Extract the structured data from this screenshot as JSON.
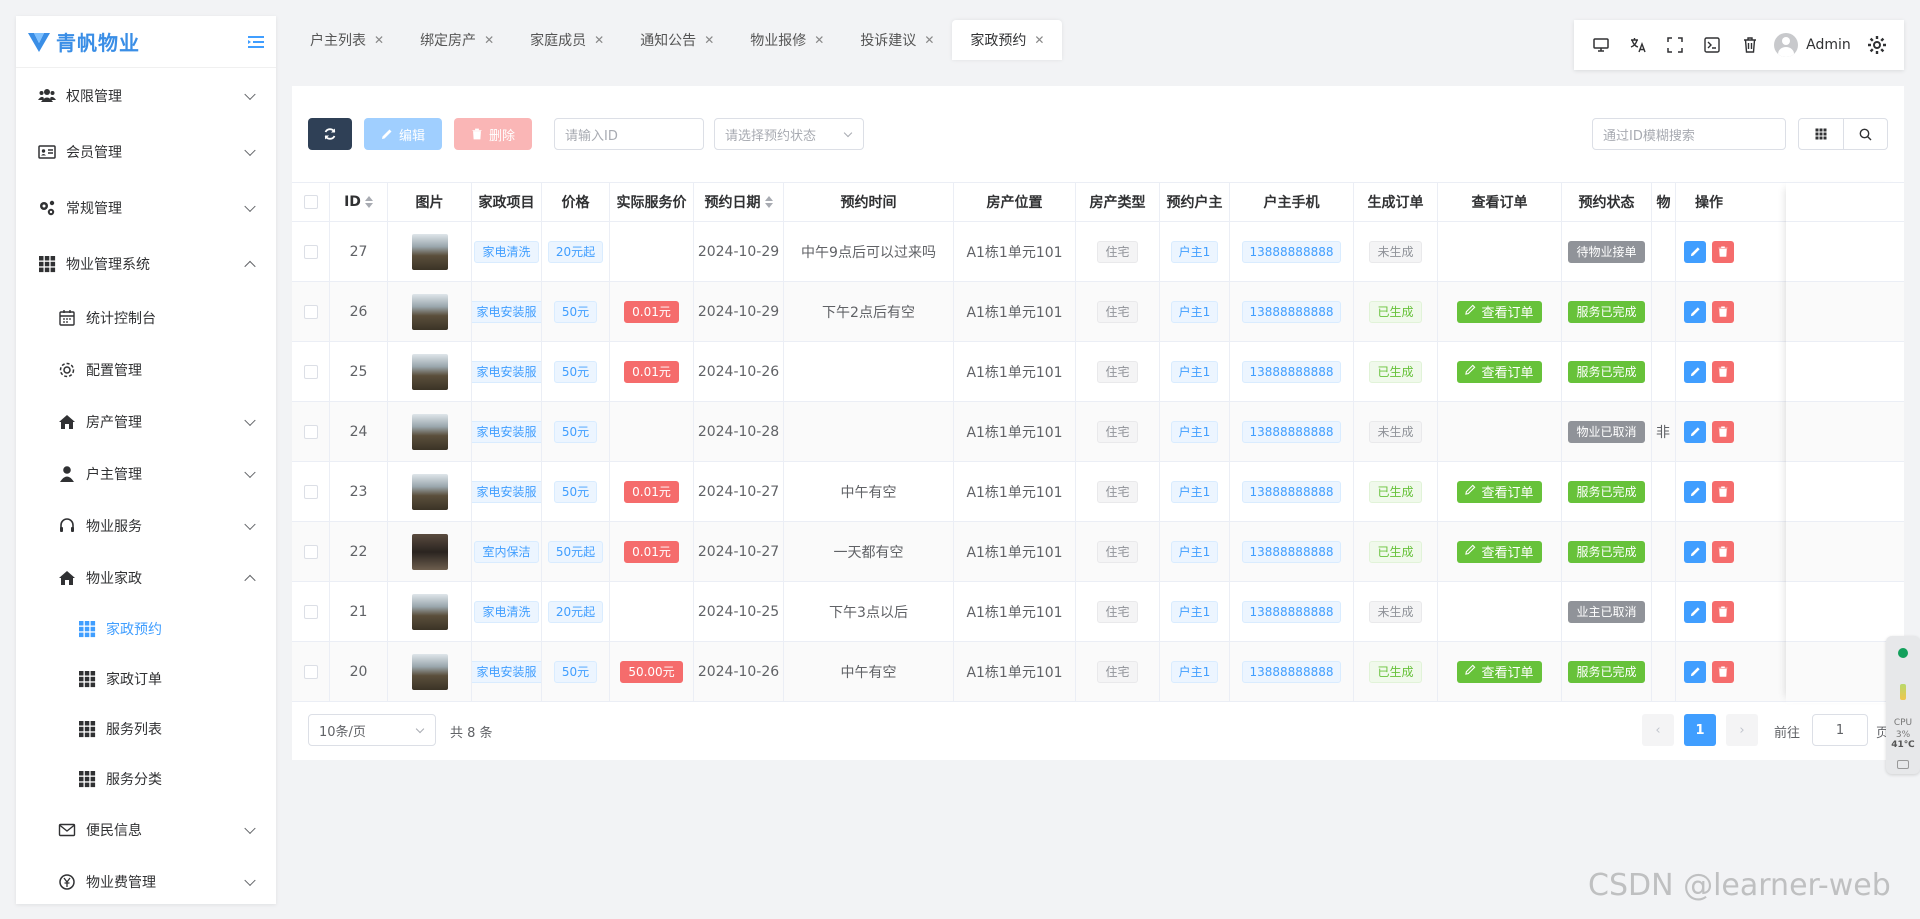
{
  "app": {
    "logo_text": "青帆物业"
  },
  "sidebar": {
    "items": [
      {
        "label": "权限管理",
        "level": 0,
        "icon": "users-icon",
        "chevron": "down"
      },
      {
        "label": "会员管理",
        "level": 0,
        "icon": "id-card-icon",
        "chevron": "down"
      },
      {
        "label": "常规管理",
        "level": 0,
        "icon": "gears-icon",
        "chevron": "down"
      },
      {
        "label": "物业管理系统",
        "level": 0,
        "icon": "grid-icon",
        "chevron": "up"
      },
      {
        "label": "统计控制台",
        "level": 1,
        "icon": "calendar-icon",
        "chevron": ""
      },
      {
        "label": "配置管理",
        "level": 1,
        "icon": "gear-icon",
        "chevron": ""
      },
      {
        "label": "房产管理",
        "level": 1,
        "icon": "home-icon",
        "chevron": "down"
      },
      {
        "label": "户主管理",
        "level": 1,
        "icon": "user-icon",
        "chevron": "down"
      },
      {
        "label": "物业服务",
        "level": 1,
        "icon": "headset-icon",
        "chevron": "down"
      },
      {
        "label": "物业家政",
        "level": 1,
        "icon": "home-icon",
        "chevron": "up"
      },
      {
        "label": "家政预约",
        "level": 2,
        "icon": "grid-icon",
        "chevron": "",
        "active": true
      },
      {
        "label": "家政订单",
        "level": 2,
        "icon": "grid-icon",
        "chevron": ""
      },
      {
        "label": "服务列表",
        "level": 2,
        "icon": "grid-icon",
        "chevron": ""
      },
      {
        "label": "服务分类",
        "level": 2,
        "icon": "grid-icon",
        "chevron": ""
      },
      {
        "label": "便民信息",
        "level": 1,
        "icon": "mail-icon",
        "chevron": "down"
      },
      {
        "label": "物业费管理",
        "level": 1,
        "icon": "money-icon",
        "chevron": "down"
      }
    ]
  },
  "tabs": [
    {
      "label": "户主列表",
      "active": false
    },
    {
      "label": "绑定房产",
      "active": false
    },
    {
      "label": "家庭成员",
      "active": false
    },
    {
      "label": "通知公告",
      "active": false
    },
    {
      "label": "物业报修",
      "active": false
    },
    {
      "label": "投诉建议",
      "active": false
    },
    {
      "label": "家政预约",
      "active": true
    }
  ],
  "topbar": {
    "user": "Admin"
  },
  "toolbar": {
    "edit_label": "编辑",
    "delete_label": "删除",
    "id_placeholder": "请输入ID",
    "status_placeholder": "请选择预约状态",
    "search_placeholder": "通过ID模糊搜索"
  },
  "table": {
    "headers": [
      "ID",
      "图片",
      "家政项目",
      "价格",
      "实际服务价",
      "预约日期",
      "预约时间",
      "房产位置",
      "房产类型",
      "预约户主",
      "户主手机",
      "生成订单",
      "查看订单",
      "预约状态",
      "物",
      "操作"
    ],
    "view_order_label": "查看订单",
    "rows": [
      {
        "id": "27",
        "img": "light",
        "project": "家电清洗",
        "price": "20元起",
        "actual": "",
        "date": "2024-10-29",
        "time": "中午9点后可以过来吗",
        "location": "A1栋1单元101",
        "type": "住宅",
        "owner": "户主1",
        "phone": "13888888888",
        "order": "未生成",
        "order_state": "none",
        "view": false,
        "status": "待物业接单",
        "status_color": "gray",
        "extra": ""
      },
      {
        "id": "26",
        "img": "light",
        "project": "家电安装服",
        "price": "50元",
        "actual": "0.01元",
        "date": "2024-10-29",
        "time": "下午2点后有空",
        "location": "A1栋1单元101",
        "type": "住宅",
        "owner": "户主1",
        "phone": "13888888888",
        "order": "已生成",
        "order_state": "done",
        "view": true,
        "status": "服务已完成",
        "status_color": "green",
        "extra": ""
      },
      {
        "id": "25",
        "img": "light",
        "project": "家电安装服",
        "price": "50元",
        "actual": "0.01元",
        "date": "2024-10-26",
        "time": "",
        "location": "A1栋1单元101",
        "type": "住宅",
        "owner": "户主1",
        "phone": "13888888888",
        "order": "已生成",
        "order_state": "done",
        "view": true,
        "status": "服务已完成",
        "status_color": "green",
        "extra": ""
      },
      {
        "id": "24",
        "img": "light",
        "project": "家电安装服",
        "price": "50元",
        "actual": "",
        "date": "2024-10-28",
        "time": "",
        "location": "A1栋1单元101",
        "type": "住宅",
        "owner": "户主1",
        "phone": "13888888888",
        "order": "未生成",
        "order_state": "none",
        "view": false,
        "status": "物业已取消",
        "status_color": "gray",
        "extra": "非"
      },
      {
        "id": "23",
        "img": "light",
        "project": "家电安装服",
        "price": "50元",
        "actual": "0.01元",
        "date": "2024-10-27",
        "time": "中午有空",
        "location": "A1栋1单元101",
        "type": "住宅",
        "owner": "户主1",
        "phone": "13888888888",
        "order": "已生成",
        "order_state": "done",
        "view": true,
        "status": "服务已完成",
        "status_color": "green",
        "extra": ""
      },
      {
        "id": "22",
        "img": "dark",
        "project": "室内保洁",
        "price": "50元起",
        "actual": "0.01元",
        "date": "2024-10-27",
        "time": "一天都有空",
        "location": "A1栋1单元101",
        "type": "住宅",
        "owner": "户主1",
        "phone": "13888888888",
        "order": "已生成",
        "order_state": "done",
        "view": true,
        "status": "服务已完成",
        "status_color": "green",
        "extra": ""
      },
      {
        "id": "21",
        "img": "light",
        "project": "家电清洗",
        "price": "20元起",
        "actual": "",
        "date": "2024-10-25",
        "time": "下午3点以后",
        "location": "A1栋1单元101",
        "type": "住宅",
        "owner": "户主1",
        "phone": "13888888888",
        "order": "未生成",
        "order_state": "none",
        "view": false,
        "status": "业主已取消",
        "status_color": "gray",
        "extra": ""
      },
      {
        "id": "20",
        "img": "light",
        "project": "家电安装服",
        "price": "50元",
        "actual": "50.00元",
        "date": "2024-10-26",
        "time": "中午有空",
        "location": "A1栋1单元101",
        "type": "住宅",
        "owner": "户主1",
        "phone": "13888888888",
        "order": "已生成",
        "order_state": "done",
        "view": true,
        "status": "服务已完成",
        "status_color": "green",
        "extra": ""
      }
    ]
  },
  "pagination": {
    "page_size": "10条/页",
    "total": "共 8 条",
    "current": "1",
    "goto_label": "前往",
    "goto_value": "1",
    "page_suffix": "页"
  },
  "widget": {
    "cpu_label": "CPU",
    "cpu_value": "3%",
    "temp": "41℃"
  },
  "watermark": "CSDN @learner-web",
  "colors": {
    "primary": "#409eff",
    "danger": "#f56c6c",
    "success": "#67c23a",
    "dark_btn": "#2f4056"
  }
}
